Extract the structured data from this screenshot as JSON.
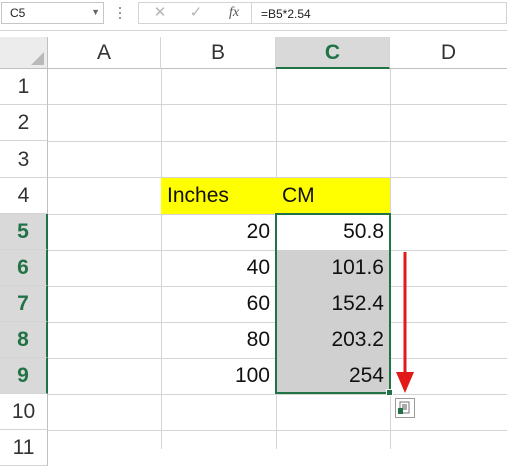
{
  "formula_bar": {
    "name_box": "C5",
    "cancel_glyph": "✕",
    "enter_glyph": "✓",
    "fx_label": "fx",
    "formula": "=B5*2.54"
  },
  "grid": {
    "selected_column": "C",
    "selected_rows": [
      "5",
      "6",
      "7",
      "8",
      "9"
    ],
    "columns": [
      "A",
      "B",
      "C",
      "D"
    ],
    "rows": [
      "1",
      "2",
      "3",
      "4",
      "5",
      "6",
      "7",
      "8",
      "9",
      "10",
      "11"
    ],
    "header_row": {
      "B": "Inches",
      "C": "CM"
    },
    "data": [
      {
        "row": "5",
        "inches": "20",
        "cm": "50.8"
      },
      {
        "row": "6",
        "inches": "40",
        "cm": "101.6"
      },
      {
        "row": "7",
        "inches": "60",
        "cm": "152.4"
      },
      {
        "row": "8",
        "inches": "80",
        "cm": "203.2"
      },
      {
        "row": "9",
        "inches": "100",
        "cm": "254"
      }
    ]
  },
  "colors": {
    "accent_green": "#217346",
    "highlight_yellow": "#ffff00",
    "fill_gray": "#d0d0d0",
    "arrow_red": "#e11919"
  },
  "icons": {
    "name_box_dropdown": "chevron-down-icon",
    "arrow": "down-arrow-icon",
    "autofill_options": "auto-fill-options-icon"
  }
}
